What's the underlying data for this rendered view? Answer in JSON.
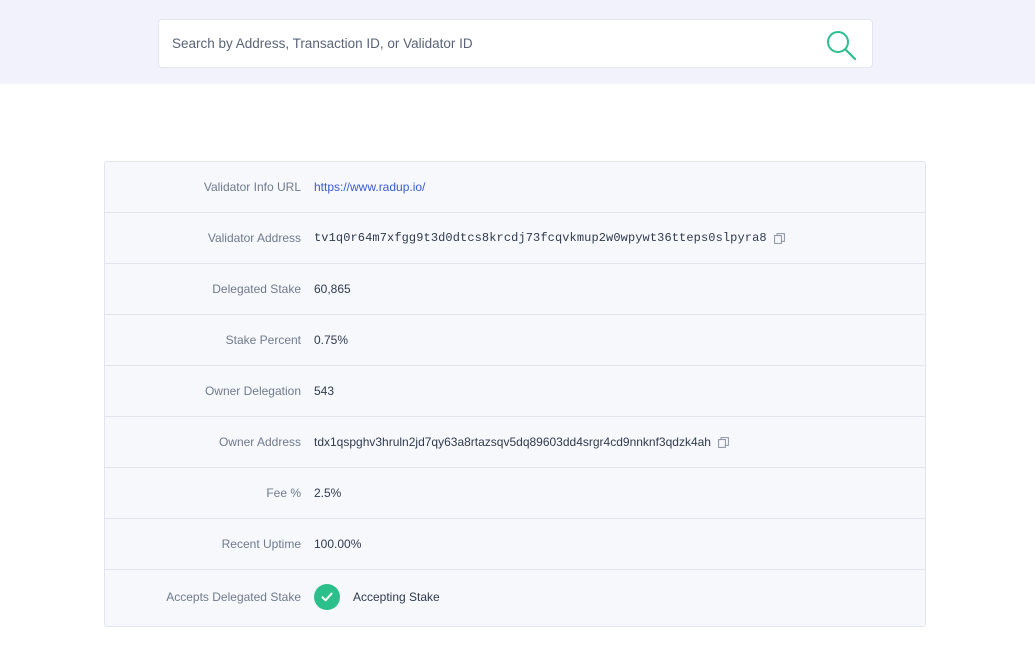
{
  "search": {
    "placeholder": "Search by Address, Transaction ID, or Validator ID",
    "value": ""
  },
  "validator": {
    "rows": [
      {
        "label": "Validator Info URL",
        "value": "https://www.radup.io/"
      },
      {
        "label": "Validator Address",
        "value": "tv1q0r64m7xfgg9t3d0dtcs8krcdj73fcqvkmup2w0wpywt36tteps0slpyra8"
      },
      {
        "label": "Delegated Stake",
        "value": "60,865"
      },
      {
        "label": "Stake Percent",
        "value": "0.75%"
      },
      {
        "label": "Owner Delegation",
        "value": "543"
      },
      {
        "label": "Owner Address",
        "value": "tdx1qspghv3hruln2jd7qy63a8rtazsqv5dq89603dd4srgr4cd9nnknf3qdzk4ah"
      },
      {
        "label": "Fee %",
        "value": "2.5%"
      },
      {
        "label": "Recent Uptime",
        "value": "100.00%"
      },
      {
        "label": "Accepts Delegated Stake",
        "value": "Accepting Stake"
      }
    ]
  },
  "colors": {
    "accent_green": "#2bbf8c",
    "link_blue": "#3a5bd0",
    "search_band": "#f1f2fb"
  },
  "icons": {
    "search": "search-icon",
    "copy": "copy-icon",
    "check": "check-icon"
  }
}
